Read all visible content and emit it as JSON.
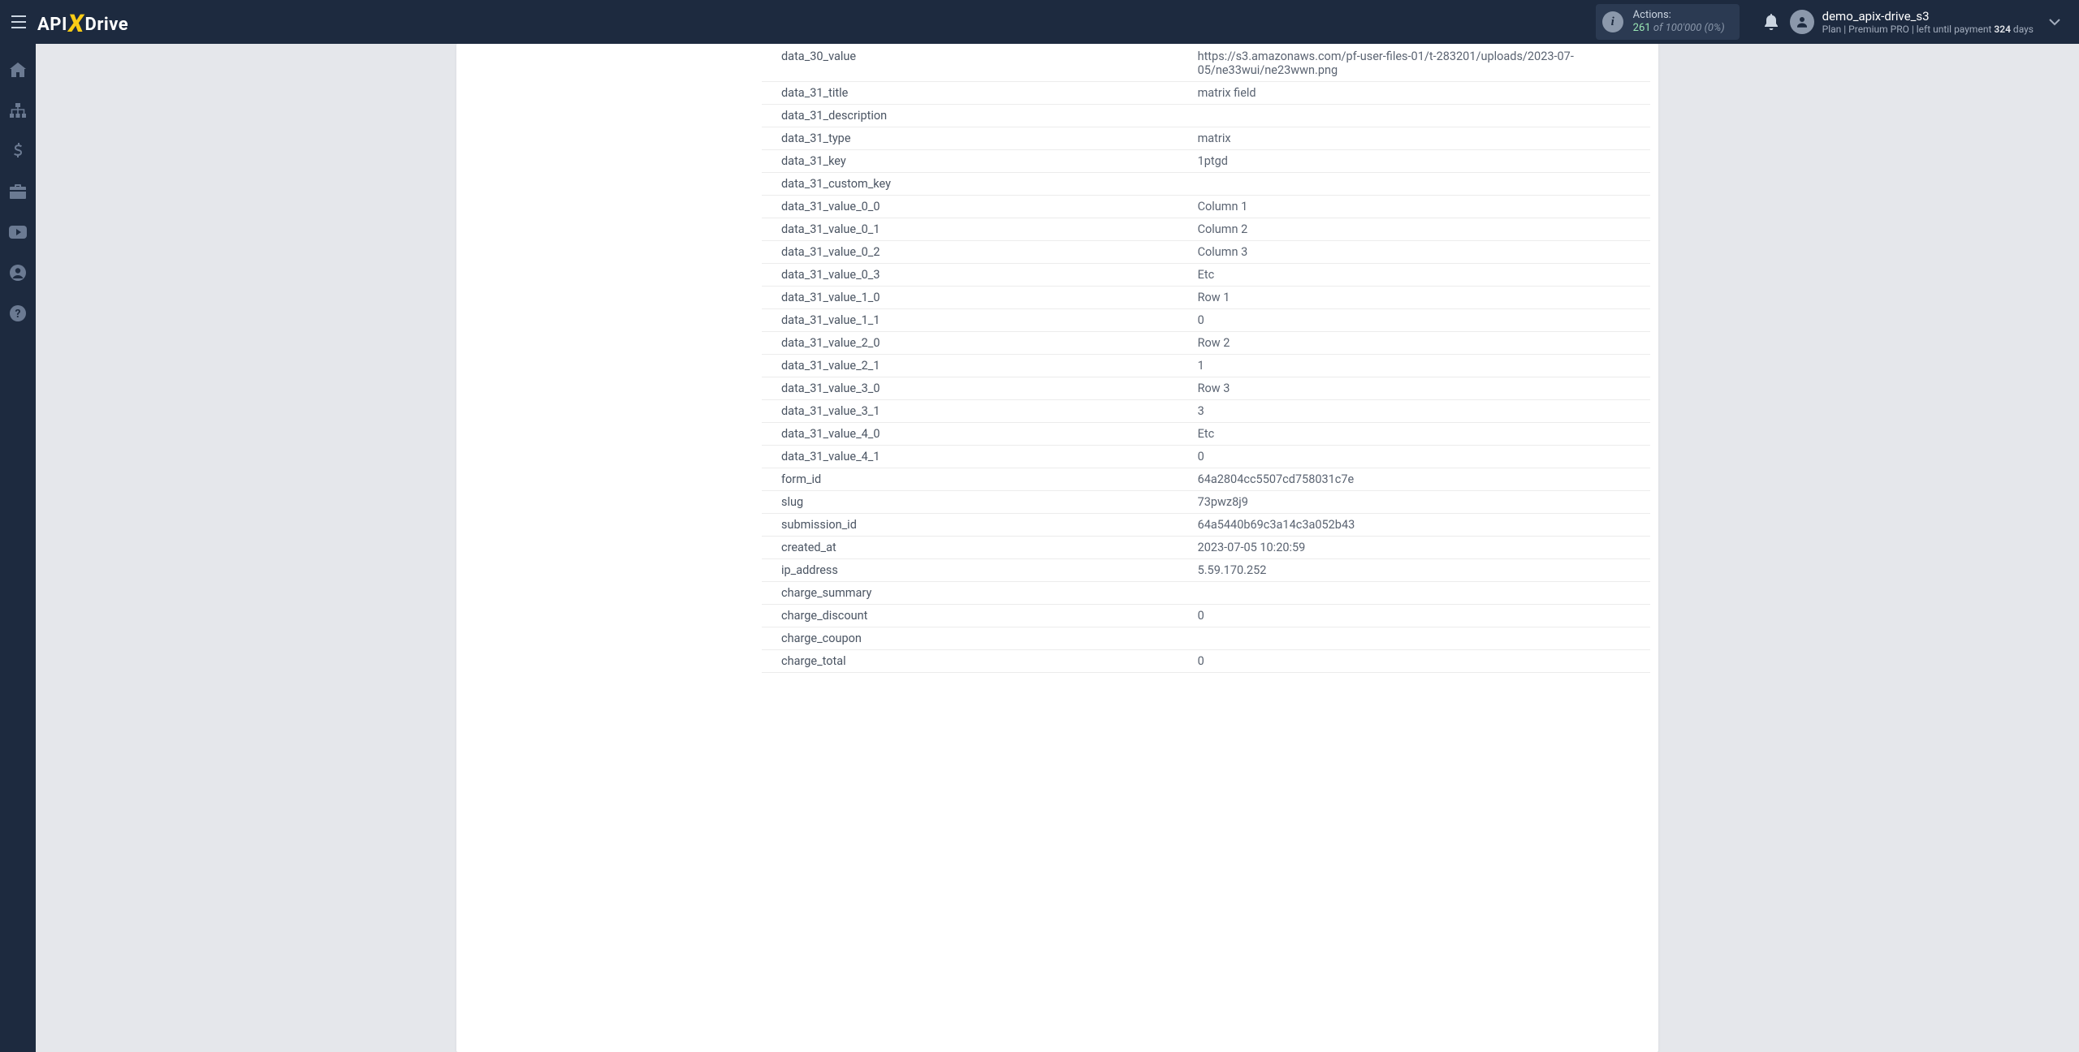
{
  "topbar": {
    "logo_prefix": "API",
    "logo_suffix": "Drive",
    "actions": {
      "label": "Actions:",
      "count": "261",
      "of": "of",
      "total": "100'000",
      "pct": "(0%)"
    },
    "user": {
      "name": "demo_apix-drive_s3",
      "plan_prefix": "Plan |",
      "plan_name": "Premium PRO",
      "left_prefix": "| left until payment",
      "days_value": "324",
      "days_suffix": "days"
    }
  },
  "rows": [
    {
      "k": "data_30_value",
      "v": "https://s3.amazonaws.com/pf-user-files-01/t-283201/uploads/2023-07-05/ne33wui/ne23wwn.png"
    },
    {
      "k": "data_31_title",
      "v": "matrix field"
    },
    {
      "k": "data_31_description",
      "v": ""
    },
    {
      "k": "data_31_type",
      "v": "matrix"
    },
    {
      "k": "data_31_key",
      "v": "1ptgd"
    },
    {
      "k": "data_31_custom_key",
      "v": ""
    },
    {
      "k": "data_31_value_0_0",
      "v": "Column 1"
    },
    {
      "k": "data_31_value_0_1",
      "v": "Column 2"
    },
    {
      "k": "data_31_value_0_2",
      "v": "Column 3"
    },
    {
      "k": "data_31_value_0_3",
      "v": "Etc"
    },
    {
      "k": "data_31_value_1_0",
      "v": "Row 1"
    },
    {
      "k": "data_31_value_1_1",
      "v": "0"
    },
    {
      "k": "data_31_value_2_0",
      "v": "Row 2"
    },
    {
      "k": "data_31_value_2_1",
      "v": "1"
    },
    {
      "k": "data_31_value_3_0",
      "v": "Row 3"
    },
    {
      "k": "data_31_value_3_1",
      "v": "3"
    },
    {
      "k": "data_31_value_4_0",
      "v": "Etc"
    },
    {
      "k": "data_31_value_4_1",
      "v": "0"
    },
    {
      "k": "form_id",
      "v": "64a2804cc5507cd758031c7e"
    },
    {
      "k": "slug",
      "v": "73pwz8j9"
    },
    {
      "k": "submission_id",
      "v": "64a5440b69c3a14c3a052b43"
    },
    {
      "k": "created_at",
      "v": "2023-07-05 10:20:59"
    },
    {
      "k": "ip_address",
      "v": "5.59.170.252"
    },
    {
      "k": "charge_summary",
      "v": ""
    },
    {
      "k": "charge_discount",
      "v": "0"
    },
    {
      "k": "charge_coupon",
      "v": ""
    },
    {
      "k": "charge_total",
      "v": "0"
    }
  ]
}
